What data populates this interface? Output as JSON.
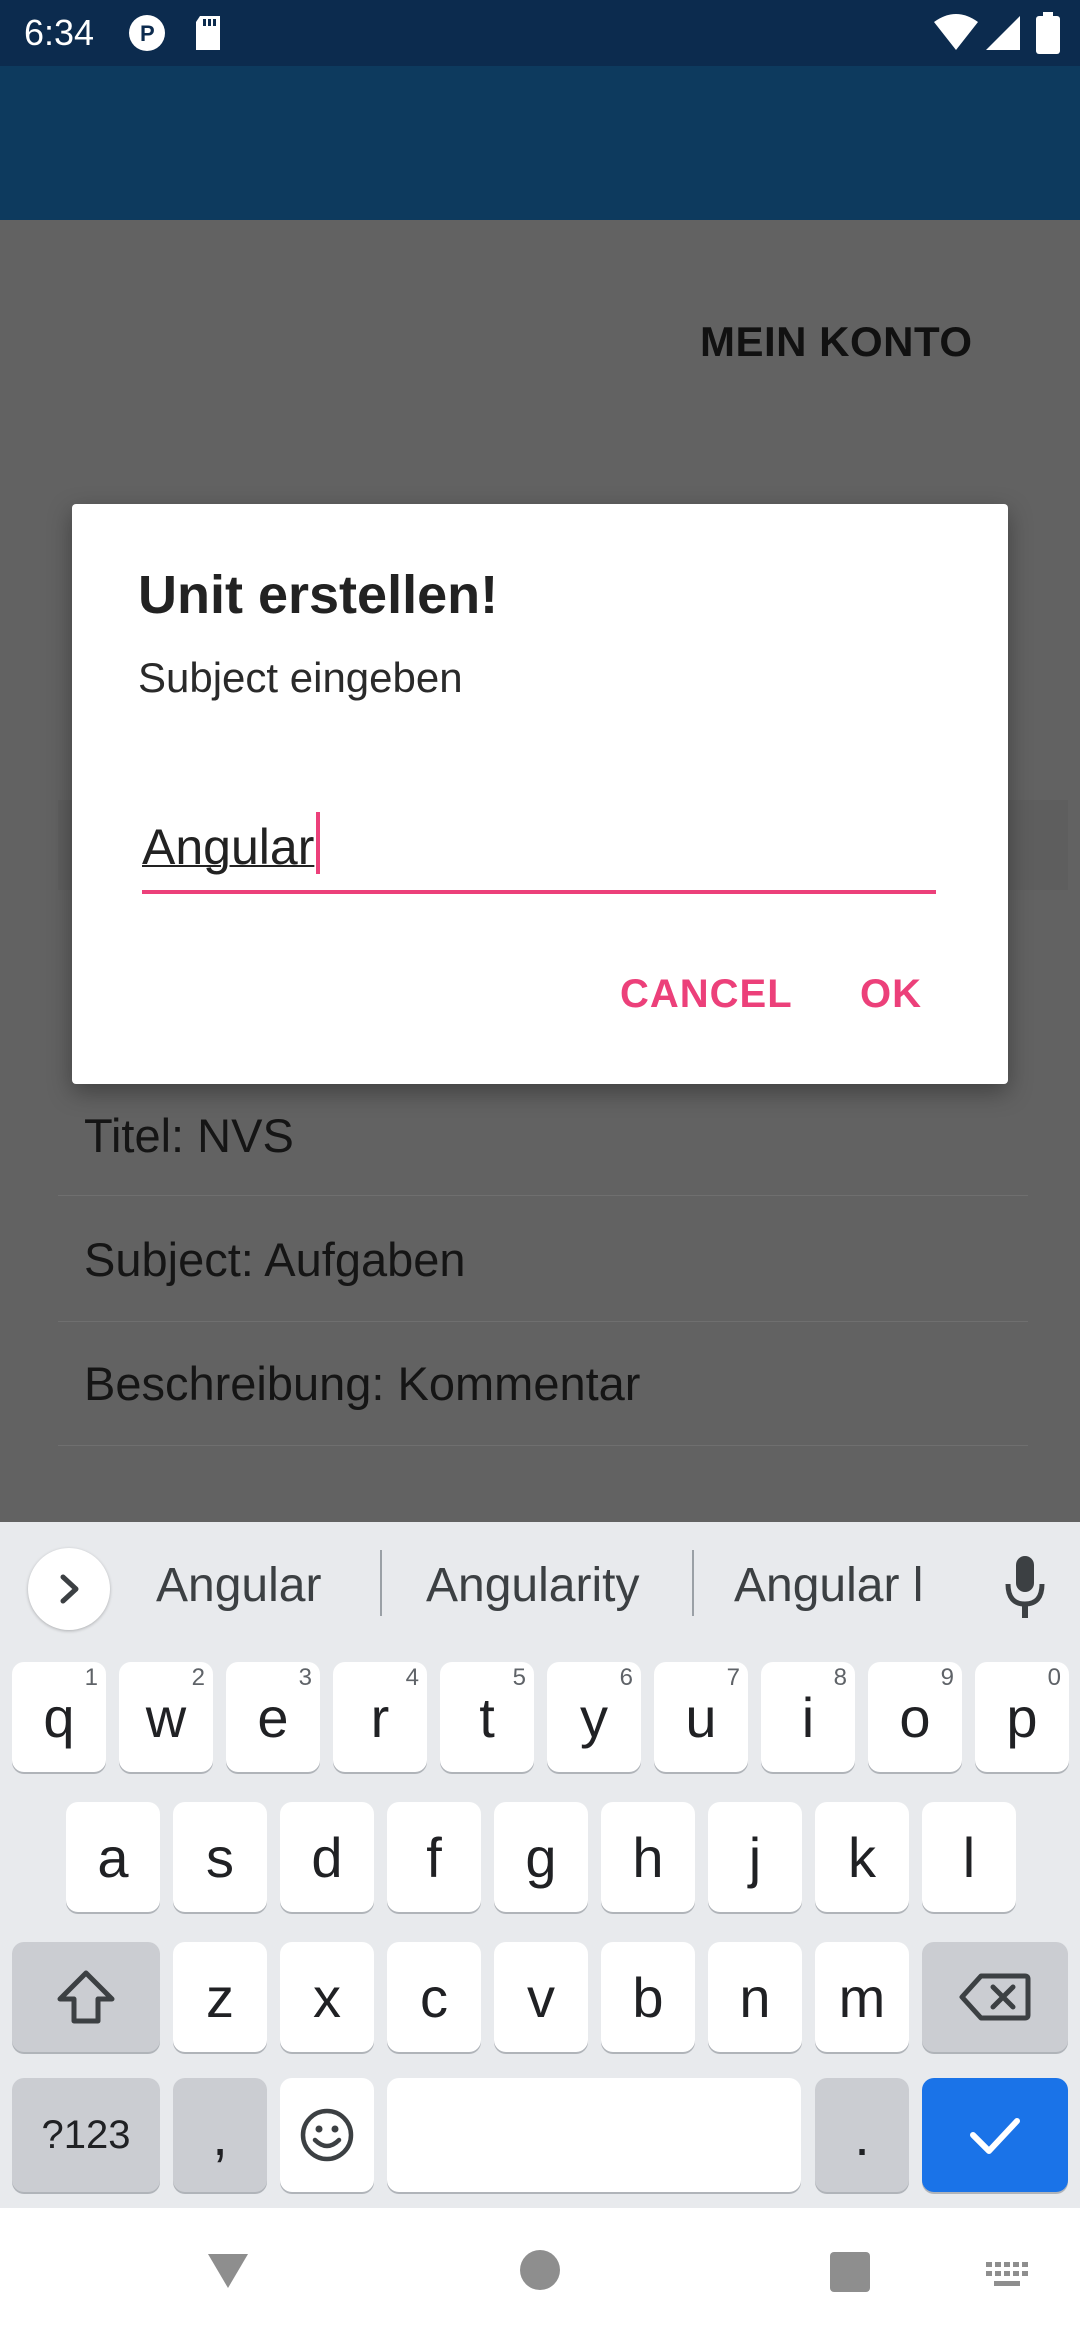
{
  "status_bar": {
    "time": "6:34",
    "icons": [
      "p-app-icon",
      "sd-card-icon",
      "wifi-icon",
      "signal-icon",
      "battery-icon"
    ]
  },
  "background": {
    "account_button": "MEIN KONTO",
    "rows": [
      {
        "label": "Titel: NVS"
      },
      {
        "label": "Subject: Aufgaben"
      },
      {
        "label": "Beschreibung: Kommentar"
      }
    ]
  },
  "dialog": {
    "title": "Unit erstellen!",
    "message": "Subject eingeben",
    "input_value": "Angular",
    "cancel_label": "CANCEL",
    "ok_label": "OK"
  },
  "keyboard": {
    "suggestions": [
      "Angular",
      "Angularity",
      "Angular l"
    ],
    "row1": [
      {
        "k": "q",
        "h": "1"
      },
      {
        "k": "w",
        "h": "2"
      },
      {
        "k": "e",
        "h": "3"
      },
      {
        "k": "r",
        "h": "4"
      },
      {
        "k": "t",
        "h": "5"
      },
      {
        "k": "y",
        "h": "6"
      },
      {
        "k": "u",
        "h": "7"
      },
      {
        "k": "i",
        "h": "8"
      },
      {
        "k": "o",
        "h": "9"
      },
      {
        "k": "p",
        "h": "0"
      }
    ],
    "row2": [
      "a",
      "s",
      "d",
      "f",
      "g",
      "h",
      "j",
      "k",
      "l"
    ],
    "row3": [
      "z",
      "x",
      "c",
      "v",
      "b",
      "n",
      "m"
    ],
    "symbols_label": "?123",
    "comma": ",",
    "period": "."
  },
  "colors": {
    "accent": "#ec407a",
    "status_bar": "#0c2b4e",
    "app_bar": "#0d3a5e",
    "enter_key": "#1a73e8"
  }
}
